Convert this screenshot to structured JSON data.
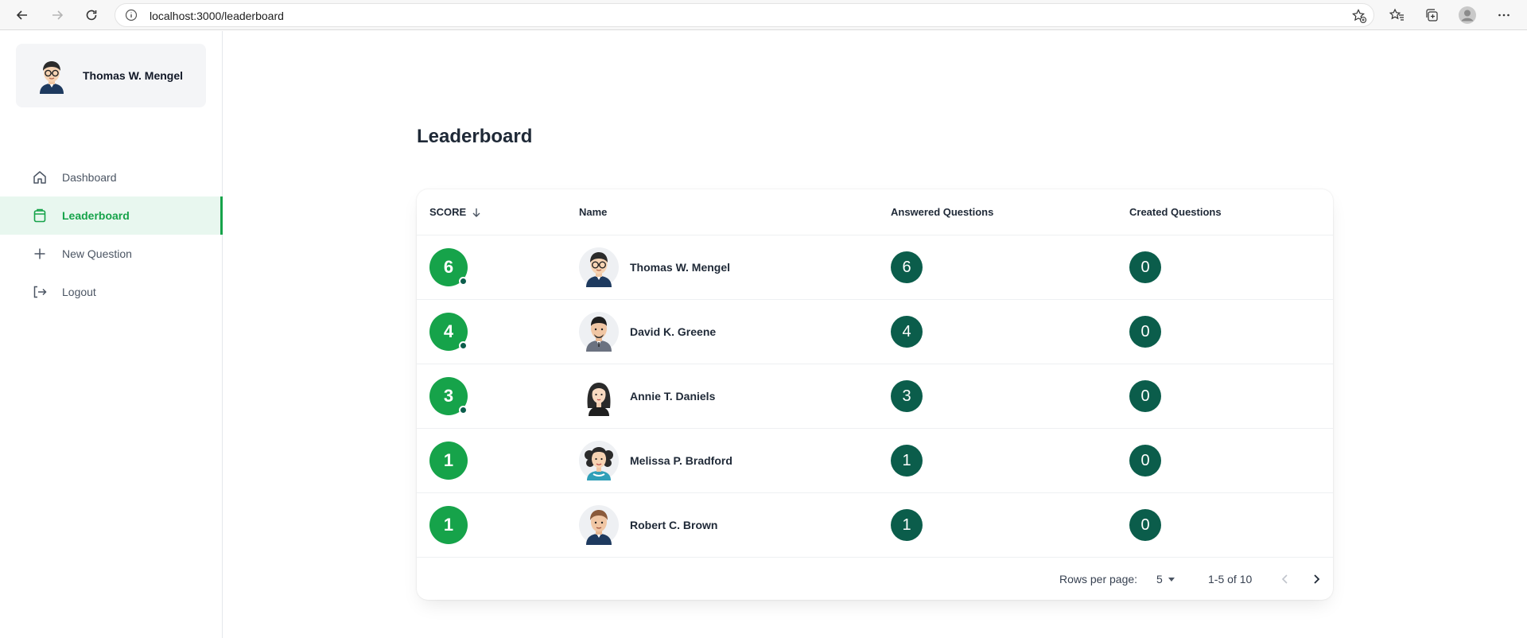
{
  "browser": {
    "url": "localhost:3000/leaderboard"
  },
  "sidebar": {
    "user_name": "Thomas W. Mengel",
    "items": [
      {
        "label": "Dashboard",
        "icon": "home-icon"
      },
      {
        "label": "Leaderboard",
        "icon": "clipboard-icon",
        "active": true
      },
      {
        "label": "New Question",
        "icon": "plus-icon"
      },
      {
        "label": "Logout",
        "icon": "logout-icon"
      }
    ]
  },
  "main": {
    "title": "Leaderboard",
    "table": {
      "headers": {
        "score": "SCORE",
        "name": "Name",
        "answered": "Answered Questions",
        "created": "Created Questions"
      },
      "rows": [
        {
          "score": "6",
          "name": "Thomas W. Mengel",
          "answered": "6",
          "created": "0",
          "dot": true
        },
        {
          "score": "4",
          "name": "David K. Greene",
          "answered": "4",
          "created": "0",
          "dot": true
        },
        {
          "score": "3",
          "name": "Annie T. Daniels",
          "answered": "3",
          "created": "0",
          "dot": true
        },
        {
          "score": "1",
          "name": "Melissa P. Bradford",
          "answered": "1",
          "created": "0",
          "dot": false
        },
        {
          "score": "1",
          "name": "Robert C. Brown",
          "answered": "1",
          "created": "0",
          "dot": false
        }
      ]
    },
    "pagination": {
      "rows_per_page_label": "Rows per page:",
      "rows_per_page": "5",
      "range": "1-5 of 10"
    }
  },
  "colors": {
    "accent_green": "#16a34a",
    "dark_teal": "#0b5d4b",
    "active_bg": "#e8f7ef"
  }
}
